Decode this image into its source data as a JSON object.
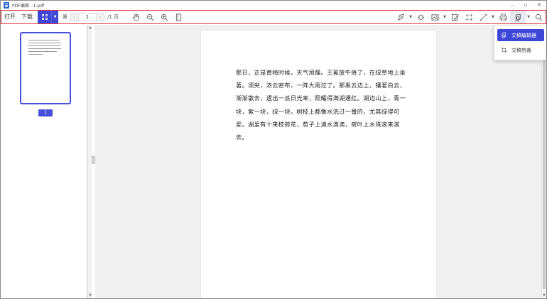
{
  "window": {
    "title": "PDF编辑 - 1.pdf",
    "controls": {
      "minimize": "–",
      "restore": "▫",
      "close": "✕"
    }
  },
  "toolbar": {
    "open_label": "打开",
    "download_label": "下载",
    "page_prefix": "第",
    "current_page": "1",
    "total_pages": "/1 页",
    "tools": [
      "hand-icon",
      "zoom-out-icon",
      "zoom-in-icon",
      "fit-page-icon",
      "pen-icon",
      "highlight-icon",
      "image-icon",
      "edit-note-icon",
      "crop-icon",
      "line-icon",
      "print-icon",
      "doc-edit-icon",
      "search-icon"
    ]
  },
  "sidebar": {
    "thumbnail_page_label": "1"
  },
  "document": {
    "paragraph": "那日，正是黄梅时候，天气烦躁。王冕放牛倦了，在绿草地上坐著。须臾，浓云密布，一阵大雨过了。那黑云边上，镶著白云，渐渐散去，透出一派日光来，照耀得满湖通红。湖边山上，青一块，紫一块，绿一块。树枝上都像水洗过一番的，尤其绿得可爱。湖里有十来枝荷花，苞子上清水滴滴，荷叶上水珠滚来滚去。"
  },
  "dropdown": {
    "items": [
      {
        "label": "文稿编辑器",
        "icon": "doc-edit-icon",
        "active": true
      },
      {
        "label": "文稿剪裁",
        "icon": "crop-icon",
        "active": false
      }
    ]
  },
  "colors": {
    "accent": "#3d46d6",
    "toolbar_border": "#e0323a"
  }
}
